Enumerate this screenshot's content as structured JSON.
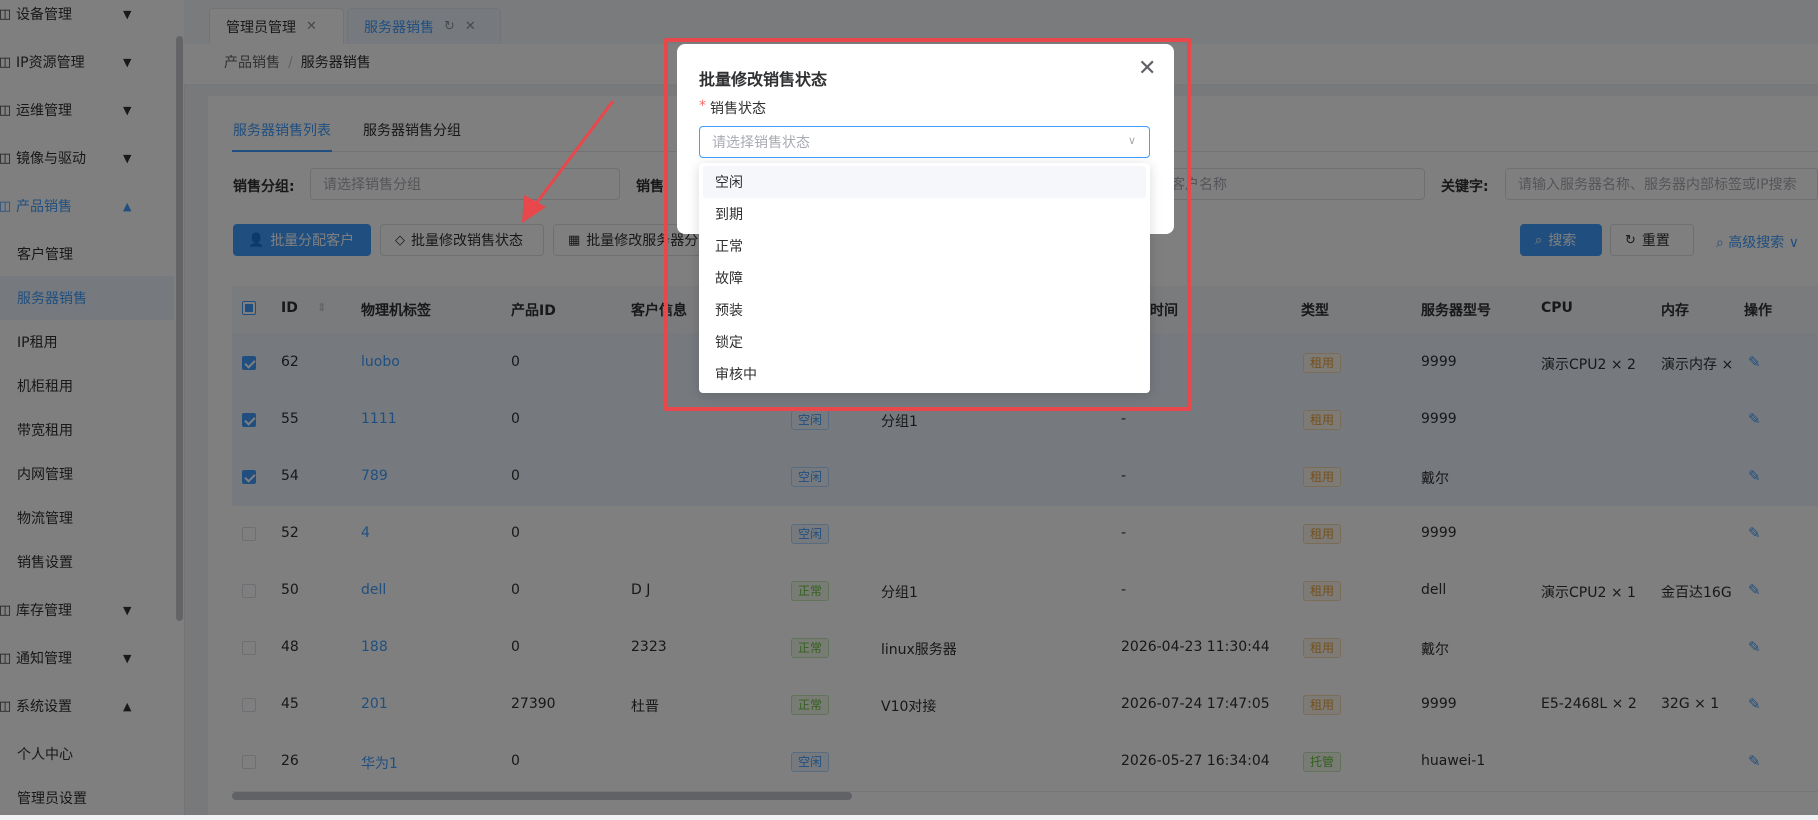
{
  "sidebar": {
    "items": [
      {
        "label": "设备管理",
        "icon": "device-icon",
        "arrow": "▼"
      },
      {
        "label": "IP资源管理",
        "icon": "ip-icon",
        "arrow": "▼"
      },
      {
        "label": "运维管理",
        "icon": "ops-icon",
        "arrow": "▼"
      },
      {
        "label": "镜像与驱动",
        "icon": "image-icon",
        "arrow": "▼"
      },
      {
        "label": "产品销售",
        "icon": "product-icon",
        "arrow": "▲"
      },
      {
        "label": "客户管理"
      },
      {
        "label": "服务器销售"
      },
      {
        "label": "IP租用"
      },
      {
        "label": "机柜租用"
      },
      {
        "label": "带宽租用"
      },
      {
        "label": "内网管理"
      },
      {
        "label": "物流管理"
      },
      {
        "label": "销售设置"
      },
      {
        "label": "库存管理",
        "icon": "stock-icon",
        "arrow": "▼"
      },
      {
        "label": "通知管理",
        "icon": "notice-icon",
        "arrow": "▼"
      },
      {
        "label": "系统设置",
        "icon": "settings-icon",
        "arrow": "▲"
      },
      {
        "label": "个人中心"
      },
      {
        "label": "管理员设置"
      }
    ]
  },
  "tabs": [
    {
      "label": "管理员管理"
    },
    {
      "label": "服务器销售"
    }
  ],
  "breadcrumb": {
    "parent": "产品销售",
    "sep": "/",
    "current": "服务器销售"
  },
  "subtabs": [
    "服务器销售列表",
    "服务器销售分组"
  ],
  "filters": {
    "group_label": "销售分组:",
    "group_placeholder": "请选择销售分组",
    "status_label": "销售",
    "customer_placeholder": "客户名称",
    "keyword_label": "关键字:",
    "keyword_placeholder": "请输入服务器名称、服务器内部标签或IP搜索"
  },
  "toolbar": {
    "assign": "批量分配客户",
    "status": "批量修改销售状态",
    "group": "批量修改服务器分",
    "search": "搜索",
    "reset": "重置",
    "advanced": "高级搜索"
  },
  "table": {
    "headers": [
      "ID",
      "物理机标签",
      "产品ID",
      "客户信息",
      "时间",
      "类型",
      "服务器型号",
      "CPU",
      "内存",
      "操作"
    ],
    "rows": [
      {
        "id": "62",
        "tag": "luobo",
        "pid": "0",
        "cust": "",
        "status": "",
        "group": "",
        "time": "",
        "type": "租用",
        "model": "9999",
        "cpu": "演示CPU2 × 2",
        "mem": "演示内存 ×",
        "selected": true
      },
      {
        "id": "55",
        "tag": "1111",
        "pid": "0",
        "cust": "",
        "status": "空闲",
        "group": "分组1",
        "time": "-",
        "type": "租用",
        "model": "9999",
        "cpu": "",
        "mem": "",
        "selected": true
      },
      {
        "id": "54",
        "tag": "789",
        "pid": "0",
        "cust": "",
        "status": "空闲",
        "group": "",
        "time": "-",
        "type": "租用",
        "model": "戴尔",
        "cpu": "",
        "mem": "",
        "selected": true
      },
      {
        "id": "52",
        "tag": "4",
        "pid": "0",
        "cust": "",
        "status": "空闲",
        "group": "",
        "time": "-",
        "type": "租用",
        "model": "9999",
        "cpu": "",
        "mem": "",
        "selected": false
      },
      {
        "id": "50",
        "tag": "dell",
        "pid": "0",
        "cust": "D J",
        "status": "正常",
        "group": "分组1",
        "time": "-",
        "type": "租用",
        "model": "dell",
        "cpu": "演示CPU2 × 1",
        "mem": "金百达16G",
        "selected": false
      },
      {
        "id": "48",
        "tag": "188",
        "pid": "0",
        "cust": "2323",
        "status": "正常",
        "group": "linux服务器",
        "time": "2026-04-23 11:30:44",
        "type": "租用",
        "model": "戴尔",
        "cpu": "",
        "mem": "",
        "selected": false
      },
      {
        "id": "45",
        "tag": "201",
        "pid": "27390",
        "cust": "杜晋",
        "status": "正常",
        "group": "V10对接",
        "time": "2026-07-24 17:47:05",
        "type": "租用",
        "model": "9999",
        "cpu": "E5-2468L × 2",
        "mem": "32G × 1",
        "selected": false
      },
      {
        "id": "26",
        "tag": "华为1",
        "pid": "0",
        "cust": "",
        "status": "空闲",
        "group": "",
        "time": "2026-05-27 16:34:04",
        "type": "托管",
        "model": "huawei-1",
        "cpu": "",
        "mem": "",
        "selected": false
      }
    ]
  },
  "dialog": {
    "title": "批量修改销售状态",
    "field_label": "销售状态",
    "required_mark": "*",
    "placeholder": "请选择销售状态",
    "options": [
      "空闲",
      "到期",
      "正常",
      "故障",
      "预装",
      "锁定",
      "审核中"
    ]
  },
  "colors": {
    "accent": "#409eff",
    "highlight": "#e8474b",
    "success": "#67c23a",
    "warning": "#e6a23c"
  }
}
